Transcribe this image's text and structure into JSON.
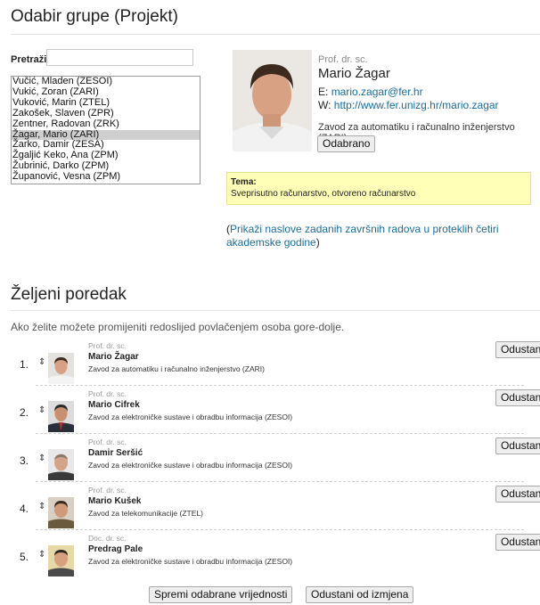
{
  "page": {
    "heading_select": "Odabir grupe (Projekt)",
    "heading_order": "Željeni poredak"
  },
  "search": {
    "label": "Pretraži:",
    "value": "",
    "placeholder": ""
  },
  "candidates": [
    "Vučić, Mladen (ZESOI)",
    "Vukić, Zoran (ZARI)",
    "Vuković, Marin (ZTEL)",
    "Zakošek, Slaven (ZPR)",
    "Zentner, Radovan (ZRK)",
    "Žagar, Mario (ZARI)",
    "Žarko, Damir (ZESA)",
    "Žgaljić Keko, Ana (ZPM)",
    "Žubrinić, Darko (ZPM)",
    "Županović, Vesna (ZPM)"
  ],
  "selected_index": 5,
  "detail": {
    "title": "Prof. dr. sc.",
    "name": "Mario Žagar",
    "email_prefix": "E:",
    "email": "mario.zagar@fer.hr",
    "web_prefix": "W:",
    "web": "http://www.fer.unizg.hr/mario.zagar",
    "department": "Zavod za automatiku i računalno inženjerstvo (ZARI)",
    "select_button": "Odabrano",
    "tema_label": "Tema:",
    "tema_value": "Sveprisutno računarstvo, otvoreno računarstvo",
    "theses_open": "(",
    "theses_link": "Prikaži naslove zadanih završnih radova u proteklih četiri akademske godine",
    "theses_close": ")"
  },
  "order": {
    "hint": "Ako želite možete promijeniti redoslijed povlačenjem osoba gore-dolje.",
    "remove_label": "Odustani",
    "items": [
      {
        "rank": "1.",
        "title": "Prof. dr. sc.",
        "name": "Mario Žagar",
        "department": "Zavod za automatiku i računalno inženjerstvo (ZARI)"
      },
      {
        "rank": "2.",
        "title": "Prof. dr. sc.",
        "name": "Mario Cifrek",
        "department": "Zavod za elektroničke sustave i obradbu informacija (ZESOI)"
      },
      {
        "rank": "3.",
        "title": "Prof. dr. sc.",
        "name": "Damir Seršić",
        "department": "Zavod za elektroničke sustave i obradbu informacija (ZESOI)"
      },
      {
        "rank": "4.",
        "title": "Prof. dr. sc.",
        "name": "Mario Kušek",
        "department": "Zavod za telekomunikacije (ZTEL)"
      },
      {
        "rank": "5.",
        "title": "Doc. dr. sc.",
        "name": "Predrag Pale",
        "department": "Zavod za elektroničke sustave i obradbu informacija (ZESOI)"
      }
    ]
  },
  "footer": {
    "save": "Spremi odabrane vrijednosti",
    "cancel": "Odustani od izmjena"
  },
  "colors": {
    "link": "#1a6d9b",
    "tema_bg": "#ffffb8",
    "selected_option_bg": "#cfcfcf"
  }
}
